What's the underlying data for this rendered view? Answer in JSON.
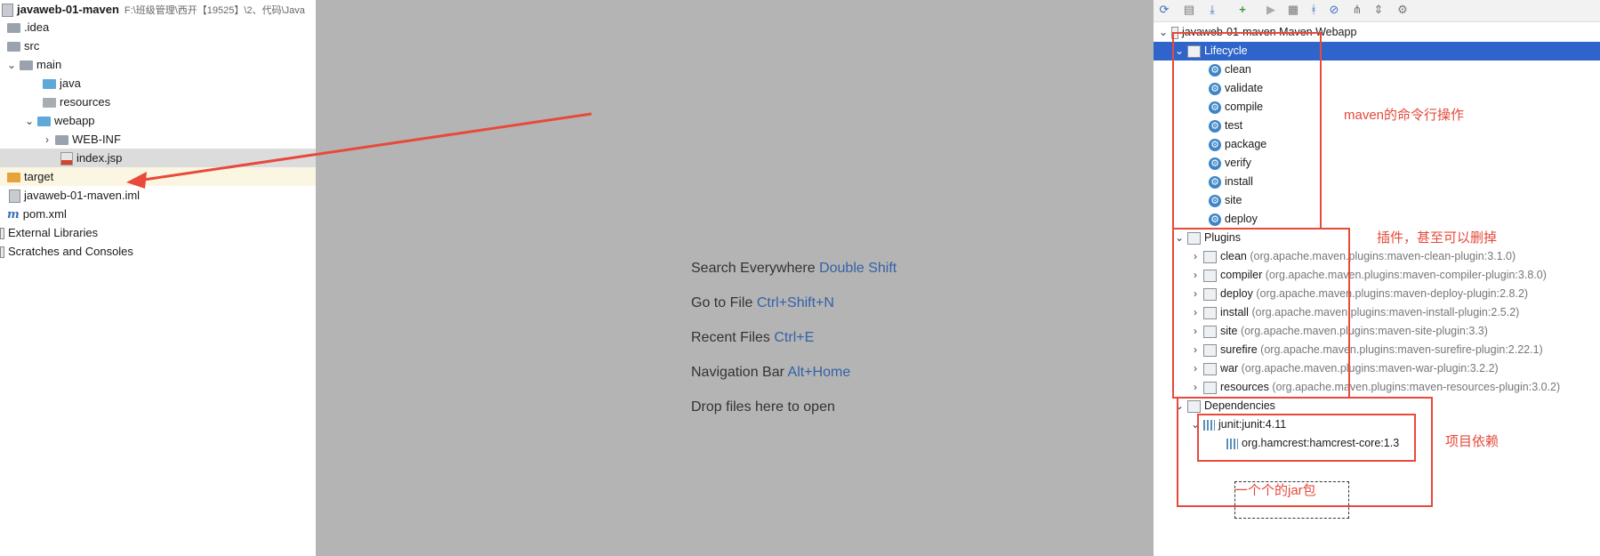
{
  "project_tree": {
    "title": "javaweb-01-maven",
    "title_path": "F:\\班级管理\\西开【19525】\\2、代码\\Java",
    "items": [
      {
        "label": ".idea"
      },
      {
        "label": "src"
      },
      {
        "label": "main"
      },
      {
        "label": "java"
      },
      {
        "label": "resources"
      },
      {
        "label": "webapp"
      },
      {
        "label": "WEB-INF"
      },
      {
        "label": "index.jsp"
      },
      {
        "label": "target"
      },
      {
        "label": "javaweb-01-maven.iml"
      },
      {
        "label": "pom.xml"
      },
      {
        "label": "External Libraries"
      },
      {
        "label": "Scratches and Consoles"
      }
    ]
  },
  "editor_hints": [
    {
      "text": "Search Everywhere",
      "key": "Double Shift"
    },
    {
      "text": "Go to File",
      "key": "Ctrl+Shift+N"
    },
    {
      "text": "Recent Files",
      "key": "Ctrl+E"
    },
    {
      "text": "Navigation Bar",
      "key": "Alt+Home"
    },
    {
      "text": "Drop files here to open",
      "key": ""
    }
  ],
  "maven": {
    "root": "javaweb-01-maven Maven Webapp",
    "lifecycle_label": "Lifecycle",
    "lifecycle": [
      "clean",
      "validate",
      "compile",
      "test",
      "package",
      "verify",
      "install",
      "site",
      "deploy"
    ],
    "plugins_label": "Plugins",
    "plugins": [
      {
        "name": "clean",
        "coord": "(org.apache.maven.plugins:maven-clean-plugin:3.1.0)"
      },
      {
        "name": "compiler",
        "coord": "(org.apache.maven.plugins:maven-compiler-plugin:3.8.0)"
      },
      {
        "name": "deploy",
        "coord": "(org.apache.maven.plugins:maven-deploy-plugin:2.8.2)"
      },
      {
        "name": "install",
        "coord": "(org.apache.maven.plugins:maven-install-plugin:2.5.2)"
      },
      {
        "name": "site",
        "coord": "(org.apache.maven.plugins:maven-site-plugin:3.3)"
      },
      {
        "name": "surefire",
        "coord": "(org.apache.maven.plugins:maven-surefire-plugin:2.22.1)"
      },
      {
        "name": "war",
        "coord": "(org.apache.maven.plugins:maven-war-plugin:3.2.2)"
      },
      {
        "name": "resources",
        "coord": "(org.apache.maven.plugins:maven-resources-plugin:3.0.2)"
      }
    ],
    "dependencies_label": "Dependencies",
    "dependencies": [
      {
        "label": "junit:junit:4.11"
      },
      {
        "label": "org.hamcrest:hamcrest-core:1.3"
      }
    ]
  },
  "annotations": {
    "lifecycle_note": "maven的命令行操作",
    "plugins_note": "插件，甚至可以删掉",
    "deps_note": "项目依赖",
    "jar_note": "一个个的jar包"
  },
  "colors": {
    "selection": "#2f65ca",
    "annotation_red": "#e8493a",
    "hint_key": "#3461a6",
    "editor_bg": "#b4b4b4"
  }
}
